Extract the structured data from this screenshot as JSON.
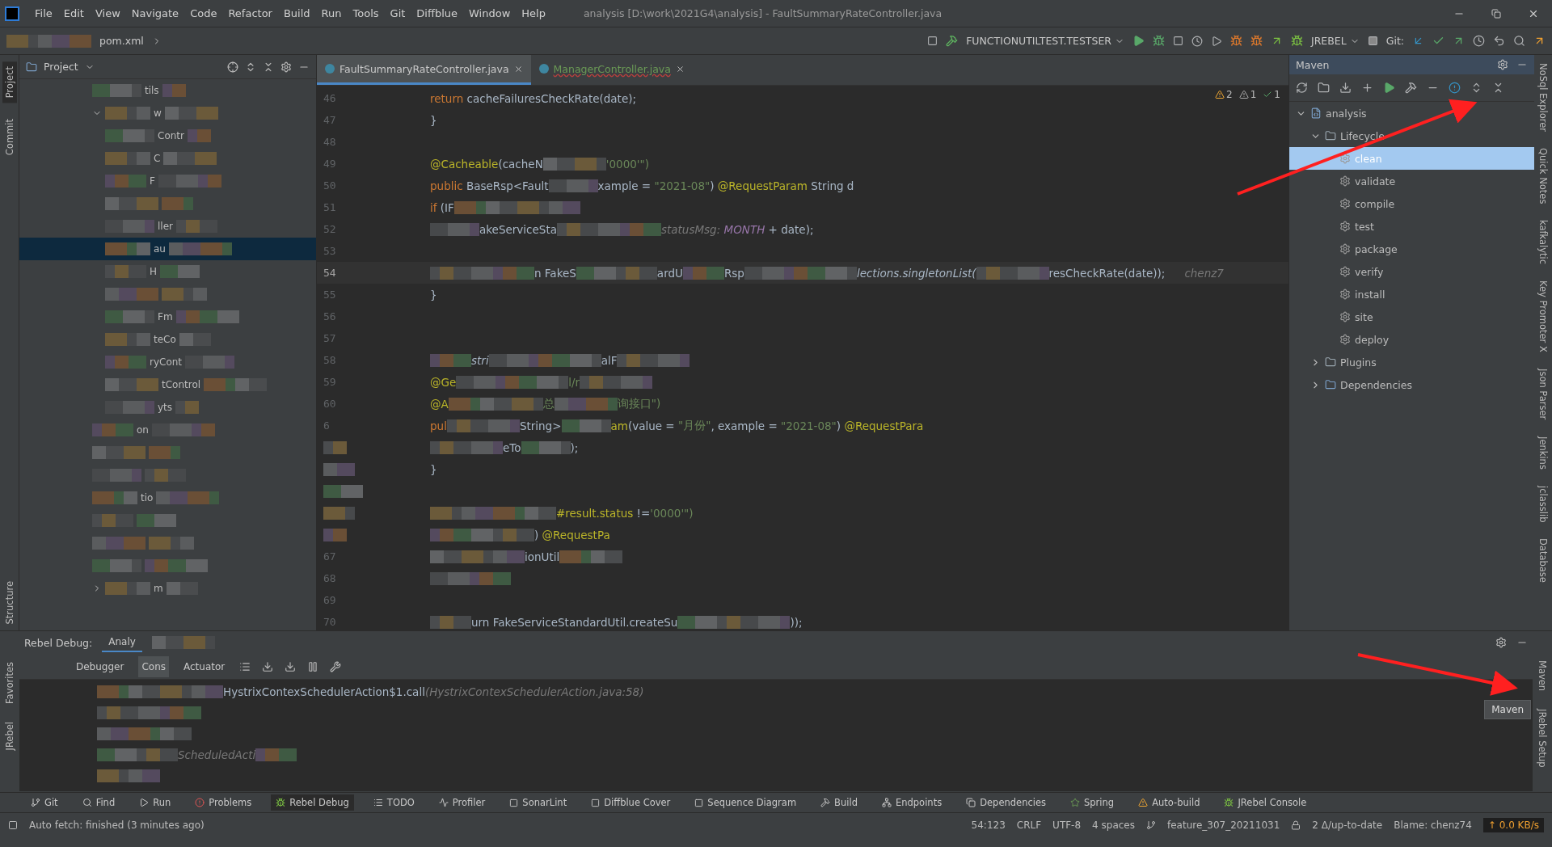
{
  "window": {
    "title": "analysis [D:\\work\\2021G4\\analysis] - FaultSummaryRateController.java"
  },
  "menu": [
    "File",
    "Edit",
    "View",
    "Navigate",
    "Code",
    "Refactor",
    "Build",
    "Run",
    "Tools",
    "Git",
    "Diffblue",
    "Window",
    "Help"
  ],
  "breadcrumb": [
    "pom.xml"
  ],
  "toolbar": {
    "run_config": "FUNCTIONUTILTEST.TESTSER",
    "jrebel": "JREBEL",
    "git_label": "Git:"
  },
  "left_strip": [
    {
      "label": "Project",
      "selected": true
    },
    {
      "label": "Commit",
      "selected": false
    },
    {
      "label": "Structure",
      "selected": false
    }
  ],
  "bottom_left_strip": [
    {
      "label": "Favorites"
    },
    {
      "label": "JRebel"
    }
  ],
  "project": {
    "title": "Project",
    "rows": [
      {
        "text": "tils",
        "selected": false
      },
      {
        "text": "w",
        "selected": false,
        "expanded": true,
        "children": [
          {
            "text": "Contr",
            "selected": false
          },
          {
            "text": "C",
            "selected": false
          },
          {
            "text": "F",
            "selected": false
          },
          {
            "selected": false
          },
          {
            "text": "ller",
            "selected": false
          },
          {
            "text": "au",
            "selected": true
          },
          {
            "text": "H",
            "selected": false
          },
          {
            "selected": false
          },
          {
            "text": "Fm",
            "selected": false
          },
          {
            "text": "teCo",
            "selected": false
          },
          {
            "text": "ryCont",
            "selected": false
          },
          {
            "text": "tControl",
            "selected": false
          },
          {
            "text": "yts",
            "selected": false
          }
        ]
      },
      {
        "text": "on",
        "selected": false
      },
      {
        "selected": false
      },
      {
        "selected": false
      },
      {
        "text": "tio",
        "selected": false
      },
      {
        "selected": false
      },
      {
        "selected": false
      },
      {
        "selected": false
      },
      {
        "text": "m",
        "selected": false,
        "expanded": false
      }
    ]
  },
  "editor": {
    "tabs": [
      {
        "label": "FaultSummaryRateController.java",
        "selected": true,
        "error": false
      },
      {
        "label": "ManagerController.java",
        "selected": false,
        "error": true
      }
    ],
    "inspections": {
      "warnings": "2",
      "weak_warnings": "1",
      "ok": "1"
    },
    "lines": [
      {
        "number": "46",
        "segments": [
          {
            "kind": "keyword",
            "text": "return "
          },
          {
            "kind": "plain",
            "text": "cacheFailuresCheckRate(date);"
          }
        ]
      },
      {
        "number": "47",
        "segments": [
          {
            "kind": "plain",
            "text": "}"
          }
        ]
      },
      {
        "number": "48"
      },
      {
        "number": "49",
        "segments": [
          {
            "kind": "annotation",
            "text": "@Cacheable"
          },
          {
            "kind": "plain",
            "text": "(cacheN"
          },
          {
            "kind": "blur"
          },
          {
            "kind": "string",
            "text": "'0000'\")"
          }
        ]
      },
      {
        "number": "50",
        "segments": [
          {
            "kind": "keyword",
            "text": "public "
          },
          {
            "kind": "plain",
            "text": "BaseRsp<Fault"
          },
          {
            "kind": "blur"
          },
          {
            "kind": "plain",
            "text": "xample = "
          },
          {
            "kind": "string",
            "text": "\"2021-08\""
          },
          {
            "kind": "plain",
            "text": ") "
          },
          {
            "kind": "annotation",
            "text": "@RequestParam "
          },
          {
            "kind": "plain",
            "text": "String d"
          }
        ]
      },
      {
        "number": "51",
        "segments": [
          {
            "kind": "keyword",
            "text": "if "
          },
          {
            "kind": "plain",
            "text": "(IF"
          },
          {
            "kind": "blur"
          }
        ]
      },
      {
        "number": "52",
        "segments": [
          {
            "kind": "blur"
          },
          {
            "kind": "plain",
            "text": "akeServiceSta"
          },
          {
            "kind": "blur"
          },
          {
            "kind": "hint",
            "text": "statusMsg:"
          },
          {
            "kind": "constant",
            "text": " MONTH"
          },
          {
            "kind": "plain",
            "text": " + date);"
          }
        ]
      },
      {
        "number": "53"
      },
      {
        "number": "54",
        "current": true,
        "segments": [
          {
            "kind": "blur"
          },
          {
            "kind": "plain",
            "text": "n FakeS"
          },
          {
            "kind": "blur"
          },
          {
            "kind": "plain",
            "text": "ardU"
          },
          {
            "kind": "blur"
          },
          {
            "kind": "plain",
            "text": "Rsp"
          },
          {
            "kind": "blur"
          },
          {
            "kind": "italic",
            "text": "lections.singletonList("
          },
          {
            "kind": "blur"
          },
          {
            "kind": "plain",
            "text": "resCheckRate(date));"
          },
          {
            "kind": "blame",
            "text": "chenz7"
          }
        ]
      },
      {
        "number": "55",
        "segments": [
          {
            "kind": "plain",
            "text": "}"
          }
        ]
      },
      {
        "number": "56"
      },
      {
        "number": "57"
      },
      {
        "number": "58",
        "segments": [
          {
            "kind": "blur"
          },
          {
            "kind": "italic",
            "text": "stri"
          },
          {
            "kind": "blur"
          },
          {
            "kind": "plain",
            "text": "alF"
          },
          {
            "kind": "blur"
          }
        ]
      },
      {
        "number": "59",
        "segments": [
          {
            "kind": "annotation",
            "text": "@Ge"
          },
          {
            "kind": "blur"
          },
          {
            "kind": "string",
            "text": "l/r"
          },
          {
            "kind": "blur"
          }
        ]
      },
      {
        "number": "60",
        "segments": [
          {
            "kind": "annotation",
            "text": "@A"
          },
          {
            "kind": "blur"
          },
          {
            "kind": "string",
            "text": "总"
          },
          {
            "kind": "blur"
          },
          {
            "kind": "string",
            "text": "询接口\")"
          }
        ]
      },
      {
        "number": "6",
        "segments": [
          {
            "kind": "keyword",
            "text": "pul"
          },
          {
            "kind": "blur"
          },
          {
            "kind": "plain",
            "text": "String>"
          },
          {
            "kind": "blur"
          },
          {
            "kind": "annotation",
            "text": "am"
          },
          {
            "kind": "plain",
            "text": "(value = "
          },
          {
            "kind": "string",
            "text": "\"月份\""
          },
          {
            "kind": "plain",
            "text": ", example = "
          },
          {
            "kind": "string",
            "text": "\"2021-08\""
          },
          {
            "kind": "plain",
            "text": ") "
          },
          {
            "kind": "annotation",
            "text": "@RequestPara"
          }
        ]
      },
      {
        "kind": "masked",
        "segments": [
          {
            "kind": "blur"
          },
          {
            "kind": "plain",
            "text": "eTo"
          },
          {
            "kind": "blur"
          },
          {
            "kind": "plain",
            "text": ");"
          }
        ]
      },
      {
        "kind": "masked",
        "segments": [
          {
            "kind": "plain",
            "text": "}"
          }
        ]
      },
      {
        "kind": "masked"
      },
      {
        "kind": "masked",
        "segments": [
          {
            "kind": "blur"
          },
          {
            "kind": "annotation",
            "text": "#result.status "
          },
          {
            "kind": "plain",
            "text": "!="
          },
          {
            "kind": "string",
            "text": "'0000'\")"
          }
        ]
      },
      {
        "kind": "masked",
        "segments": [
          {
            "kind": "blur"
          },
          {
            "kind": "plain",
            "text": ") "
          },
          {
            "kind": "annotation",
            "text": "@RequestPa"
          }
        ]
      },
      {
        "number": "67",
        "segments": [
          {
            "kind": "blur"
          },
          {
            "kind": "plain",
            "text": "ionUtil"
          },
          {
            "kind": "blur"
          }
        ]
      },
      {
        "number": "68",
        "segments": [
          {
            "kind": "blur"
          }
        ]
      },
      {
        "number": "69"
      },
      {
        "number": "70",
        "segments": [
          {
            "kind": "blur"
          },
          {
            "kind": "plain",
            "text": "urn FakeServiceStandardUtil.createSu"
          },
          {
            "kind": "blur"
          },
          {
            "kind": "plain",
            "text": "));"
          }
        ]
      }
    ]
  },
  "maven": {
    "title": "Maven",
    "tree": [
      {
        "label": "analysis",
        "kind": "project",
        "expanded": true,
        "selected": false,
        "children": [
          {
            "label": "Lifecycle",
            "kind": "folder",
            "expanded": true,
            "selected": false,
            "children": [
              {
                "label": "clean",
                "kind": "goal",
                "selected": true
              },
              {
                "label": "validate",
                "kind": "goal",
                "selected": false
              },
              {
                "label": "compile",
                "kind": "goal",
                "selected": false
              },
              {
                "label": "test",
                "kind": "goal",
                "selected": false
              },
              {
                "label": "package",
                "kind": "goal",
                "selected": false
              },
              {
                "label": "verify",
                "kind": "goal",
                "selected": false
              },
              {
                "label": "install",
                "kind": "goal",
                "selected": false
              },
              {
                "label": "site",
                "kind": "goal",
                "selected": false
              },
              {
                "label": "deploy",
                "kind": "goal",
                "selected": false
              }
            ]
          },
          {
            "label": "Plugins",
            "kind": "folder",
            "expanded": false,
            "selected": false
          },
          {
            "label": "Dependencies",
            "kind": "deps",
            "expanded": false,
            "selected": false
          }
        ]
      }
    ]
  },
  "right_strip": [
    {
      "label": "NoSql Explorer"
    },
    {
      "label": "Quick Notes"
    },
    {
      "label": "kafkalytic"
    },
    {
      "label": "Key Promoter X"
    },
    {
      "label": "Json Parser"
    },
    {
      "label": "Jenkins"
    },
    {
      "label": "jclasslib"
    },
    {
      "label": "Database"
    }
  ],
  "bottom_right_strip": [
    {
      "label": "Maven"
    },
    {
      "label": "JRebel Setup"
    }
  ],
  "tooltip": "Maven",
  "debug": {
    "title": "Rebel Debug:",
    "tab": "Analy",
    "tabs": [
      {
        "label": "Debugger",
        "selected": false
      },
      {
        "label": "Cons",
        "selected": true
      },
      {
        "label": "Actuator",
        "selected": false
      }
    ],
    "console": [
      {
        "segments": [
          {
            "kind": "blur"
          },
          {
            "kind": "plain",
            "text": "HystrixContexSchedulerAction$1.call"
          },
          {
            "kind": "hint",
            "text": "(HystrixContexSchedulerAction.java:58)"
          }
        ]
      },
      {
        "segments": [
          {
            "kind": "blur"
          }
        ]
      },
      {
        "segments": [
          {
            "kind": "blur"
          }
        ]
      },
      {
        "segments": [
          {
            "kind": "blur"
          },
          {
            "kind": "hint",
            "text": "ScheduledActi"
          },
          {
            "kind": "blur"
          }
        ]
      },
      {
        "segments": [
          {
            "kind": "blur"
          }
        ]
      }
    ]
  },
  "tool_tabs": [
    {
      "label": "Git",
      "kind": "git",
      "selected": false
    },
    {
      "label": "Find",
      "kind": "search",
      "selected": false
    },
    {
      "label": "Run",
      "kind": "run",
      "selected": false
    },
    {
      "label": "Problems",
      "kind": "problem",
      "selected": false
    },
    {
      "label": "Rebel Debug",
      "kind": "rebel",
      "selected": true
    },
    {
      "label": "TODO",
      "kind": "list",
      "selected": false
    },
    {
      "label": "Profiler",
      "kind": "profiler",
      "selected": false
    },
    {
      "label": "SonarLint",
      "kind": "sonar",
      "selected": false
    },
    {
      "label": "Diffblue Cover",
      "kind": "cover",
      "selected": false
    },
    {
      "label": "Sequence Diagram",
      "kind": "seq",
      "selected": false
    },
    {
      "label": "Build",
      "kind": "build",
      "selected": false
    },
    {
      "label": "Endpoints",
      "kind": "endpoints",
      "selected": false
    },
    {
      "label": "Dependencies",
      "kind": "deps",
      "selected": false
    },
    {
      "label": "Spring",
      "kind": "spring",
      "selected": false
    },
    {
      "label": "Auto-build",
      "kind": "warn",
      "selected": false
    },
    {
      "label": "JRebel Console",
      "kind": "rebel",
      "selected": false
    }
  ],
  "status_bar": {
    "message": "Auto fetch: finished (3 minutes ago)",
    "position": "54:123",
    "line_ending": "CRLF",
    "encoding": "UTF-8",
    "indent": "4 spaces",
    "branch": "feature_307_20211031",
    "changes": "2 Δ/up-to-date",
    "blame": "Blame: chenz74",
    "upload": "↑ 0.0 KB/s"
  }
}
